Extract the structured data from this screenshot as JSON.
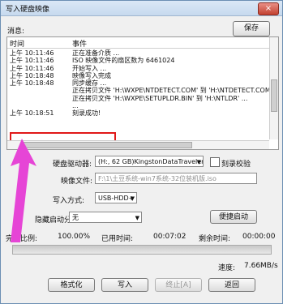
{
  "window": {
    "title": "写入硬盘映像",
    "close_icon": "×"
  },
  "messages": {
    "label": "消息:",
    "save_button": "保存",
    "columns": [
      "时间",
      "事件"
    ],
    "rows": [
      {
        "time": "上午 10:11:46",
        "event": "正在准备介质 ..."
      },
      {
        "time": "上午 10:11:46",
        "event": "ISO 映像文件的扇区数为 6461024"
      },
      {
        "time": "上午 10:11:46",
        "event": "开始写入 ..."
      },
      {
        "time": "上午 10:18:48",
        "event": "映像写入完成"
      },
      {
        "time": "上午 10:18:48",
        "event": "同步缓存 ..."
      },
      {
        "time": "",
        "event": "正在拷贝文件 'H:\\WXPE\\NTDETECT.COM' 到 'H:\\NTDETECT.COM' ..."
      },
      {
        "time": "",
        "event": "正在拷贝文件 'H:\\WXPE\\SETUPLDR.BIN' 到 'H:\\NTLDR' ..."
      },
      {
        "time": "",
        "event": "..."
      },
      {
        "time": "上午 10:18:51",
        "event": "刻录成功!"
      }
    ]
  },
  "form": {
    "drive_label": "硬盘驱动器:",
    "drive_value": "(H:, 62 GB)KingstonDataTraveler 3.0PMAP",
    "verify_label": "刻录校验",
    "image_label": "映像文件:",
    "image_value": "F:\\1\\土豆系统-win7系统-32位装机版.iso",
    "write_mode_label": "写入方式:",
    "write_mode_value": "USB-HDD+",
    "hidden_partition_label": "隐藏启动分区:",
    "hidden_partition_value": "无",
    "boot_button": "便捷启动"
  },
  "status": {
    "complete_label": "完成比例:",
    "complete_value": "100.00%",
    "elapsed_label": "已用时间:",
    "elapsed_value": "00:07:02",
    "remaining_label": "剩余时间:",
    "remaining_value": "00:00:00",
    "progress": 1.0,
    "speed_label": "速度:",
    "speed_value": "7.66MB/s"
  },
  "buttons": {
    "format": "格式化",
    "write": "写入",
    "stop": "终止[A]",
    "back": "返回"
  },
  "colors": {
    "highlight": "#e01818",
    "arrow": "#e645d6"
  }
}
